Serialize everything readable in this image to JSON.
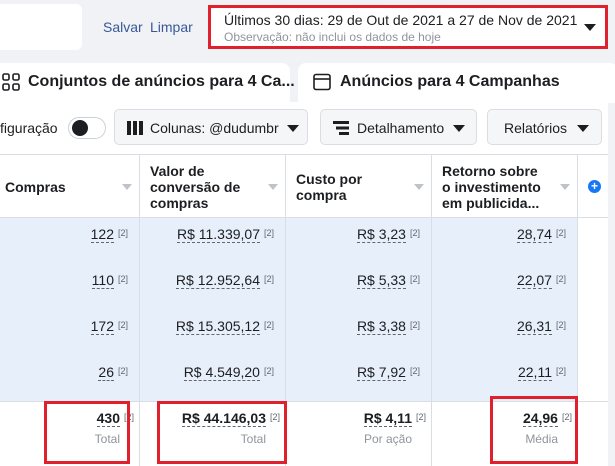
{
  "topbar": {
    "save_label": "Salvar",
    "clear_label": "Limpar",
    "date_range": "Últimos 30 dias: 29 de Out de 2021 a 27 de Nov de 2021",
    "date_note": "Observação: não inclui os dados de hoje"
  },
  "tabs": {
    "ad_sets": "Conjuntos de anúncios para 4 Ca...",
    "ads": "Anúncios para 4 Campanhas"
  },
  "toolbar": {
    "config_label": "figuração",
    "columns_label": "Colunas: @dudumbr",
    "breakdown_label": "Detalhamento",
    "reports_label": "Relatórios"
  },
  "table": {
    "headers": [
      {
        "lines": [
          "Compras"
        ]
      },
      {
        "lines": [
          "Valor de",
          "conversão de",
          "compras"
        ]
      },
      {
        "lines": [
          "Custo por",
          "compra"
        ]
      },
      {
        "lines": [
          "Retorno sobre",
          "o investimento",
          "em publicida..."
        ]
      }
    ],
    "rows": [
      {
        "purchases": "122",
        "conv_value": "R$ 11.339,07",
        "cost": "R$ 3,23",
        "roas": "28,74"
      },
      {
        "purchases": "110",
        "conv_value": "R$ 12.952,64",
        "cost": "R$ 5,33",
        "roas": "22,07"
      },
      {
        "purchases": "172",
        "conv_value": "R$ 15.305,12",
        "cost": "R$ 3,38",
        "roas": "26,31"
      },
      {
        "purchases": "26",
        "conv_value": "R$ 4.549,20",
        "cost": "R$ 7,92",
        "roas": "22,11"
      }
    ],
    "ref": "[2]",
    "totals": {
      "purchases": "430",
      "purchases_label": "Total",
      "conv_value": "R$ 44.146,03",
      "conv_value_label": "Total",
      "cost": "R$ 4,11",
      "cost_label": "Por ação",
      "roas": "24,96",
      "roas_label": "Média"
    }
  },
  "colors": {
    "highlight": "#e0202c",
    "row_bg": "#e7effb",
    "link": "#385898",
    "accent": "#1877f2"
  }
}
